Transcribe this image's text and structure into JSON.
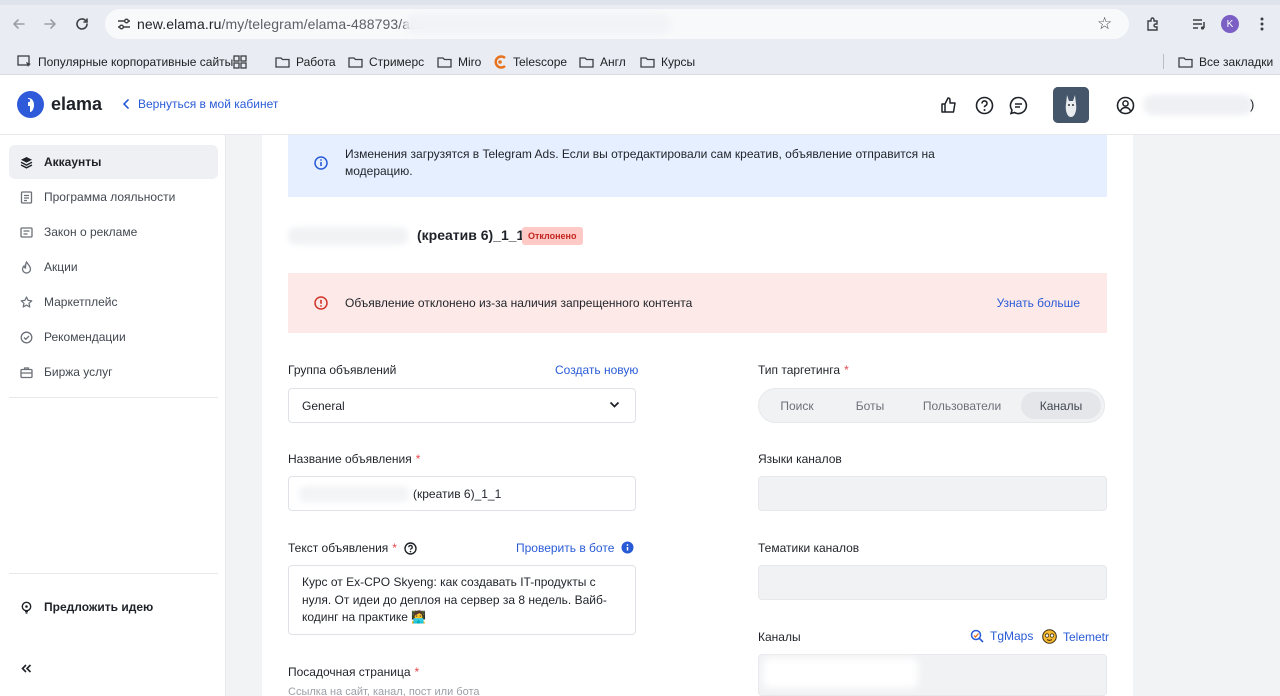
{
  "browser": {
    "url_host": "new.elama.ru",
    "url_path": "/my/telegram/elama-488793/ads/",
    "profile_initial": "K",
    "bookmarks": [
      {
        "label": "Популярные корпоративные сайты",
        "icon": "corporate-icon"
      },
      {
        "label": "Работа",
        "icon": "folder-icon"
      },
      {
        "label": "Стримерс",
        "icon": "folder-icon"
      },
      {
        "label": "Miro",
        "icon": "folder-icon"
      },
      {
        "label": "Telescope",
        "icon": "telescope-icon"
      },
      {
        "label": "Англ",
        "icon": "folder-icon"
      },
      {
        "label": "Курсы",
        "icon": "folder-icon"
      }
    ],
    "all_bookmarks": "Все закладки"
  },
  "header": {
    "logo": "elama",
    "back_link": "Вернуться в мой кабинет",
    "user_suffix": ")"
  },
  "sidebar": {
    "items": [
      {
        "label": "Аккаунты",
        "icon": "accounts-icon",
        "active": true
      },
      {
        "label": "Программа лояльности",
        "icon": "loyalty-icon"
      },
      {
        "label": "Закон о рекламе",
        "icon": "law-icon"
      },
      {
        "label": "Акции",
        "icon": "promo-icon"
      },
      {
        "label": "Маркетплейс",
        "icon": "marketplace-icon"
      },
      {
        "label": "Рекомендации",
        "icon": "recommendations-icon"
      },
      {
        "label": "Биржа услуг",
        "icon": "services-icon"
      }
    ],
    "suggest_idea": "Предложить идею",
    "collapse_icon": "collapse-icon"
  },
  "main": {
    "info_banner": "Изменения загрузятся в Telegram Ads. Если вы отредактировали сам креатив, объявление отправится на модерацию.",
    "ad_title": "(креатив 6)_1_1",
    "status_badge": "Отклонено",
    "error_banner": {
      "text": "Объявление отклонено из-за наличия запрещенного контента",
      "link": "Узнать больше"
    },
    "ad_group": {
      "label": "Группа объявлений",
      "create_link": "Создать новую",
      "value": "General"
    },
    "targeting": {
      "label": "Тип таргетинга",
      "options": [
        "Поиск",
        "Боты",
        "Пользователи",
        "Каналы"
      ],
      "selected": "Каналы"
    },
    "ad_name": {
      "label": "Название объявления",
      "value": "(креатив 6)_1_1"
    },
    "channel_languages": {
      "label": "Языки каналов"
    },
    "ad_text": {
      "label": "Текст объявления",
      "check_link": "Проверить в боте",
      "value": "Курс от Ex-CPO Skyeng: как создавать IT-продукты с нуля. От идеи до деплоя на сервер за 8 недель. Вайб-кодинг на практике 🧑‍💻"
    },
    "channel_topics": {
      "label": "Тематики каналов"
    },
    "channels": {
      "label": "Каналы",
      "link1": "TgMaps",
      "link2": "Telemetr"
    },
    "landing": {
      "label": "Посадочная страница",
      "hint": "Ссылка на сайт, канал, пост или бота"
    },
    "required_mark": "*"
  }
}
